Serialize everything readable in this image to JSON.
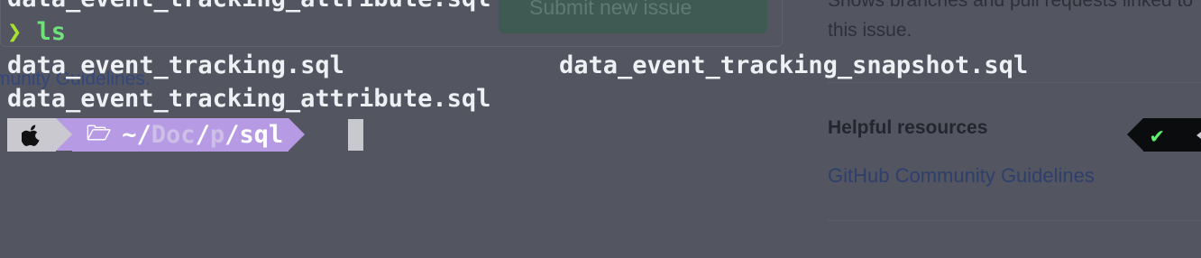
{
  "background_page": {
    "submit_button_label": "Submit new issue",
    "left_link_text": "munity Guidelines.",
    "sidebar_text": "Shows branches and pull requests linked to this issue.",
    "helpful_resources_heading": "Helpful resources",
    "community_guidelines_link": "GitHub Community Guidelines"
  },
  "terminal": {
    "previous_output_line": "data_event_tracking_attribute.sql",
    "prompt_symbol": "❯",
    "command": "ls",
    "ls_output": [
      "data_event_tracking.sql",
      "data_event_tracking_snapshot.sql",
      "data_event_tracking_attribute.sql"
    ],
    "prompt": {
      "os_icon": "apple-icon",
      "folder_icon": "🗁",
      "path_home": "~/",
      "path_dim_1": "Doc",
      "path_sep_1": "/",
      "path_dim_2": "p",
      "path_sep_2": "/",
      "path_current": "sql"
    },
    "status_symbol": "✔"
  },
  "colors": {
    "terminal_background": "#535561",
    "command_green": "#6fe37a",
    "path_segment": "#b69be4",
    "os_segment": "#c9c9cf",
    "status_segment": "#0b0c0e",
    "status_ok": "#5cf06a"
  }
}
